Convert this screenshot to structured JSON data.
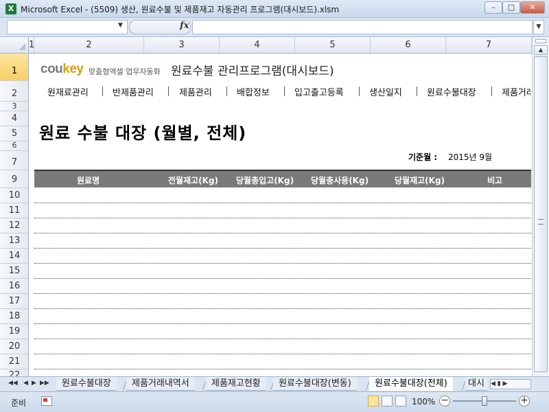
{
  "window": {
    "app_icon": "X",
    "title": "Microsoft Excel - (5509) 생산, 원료수불 및 제품재고 자동관리 프로그램(대시보드).xlsm",
    "min_icon": "minimize-icon",
    "max_icon": "maximize-icon",
    "close_icon": "close-icon"
  },
  "formula_bar": {
    "name_box": "",
    "fx": "fx",
    "formula": ""
  },
  "columns": [
    "1",
    "2",
    "3",
    "4",
    "5",
    "6",
    "7"
  ],
  "rows": [
    "1",
    "2",
    "3",
    "4",
    "5",
    "6",
    "7",
    "9",
    "10",
    "11",
    "12",
    "13",
    "14",
    "15",
    "16",
    "17",
    "18",
    "19",
    "20",
    "21",
    "22"
  ],
  "header": {
    "logo_main": "cou",
    "logo_accent": "key",
    "logo_tag": "맞춤형엑셀 업무자동화",
    "app_title": "원료수불 관리프로그램(대시보드)"
  },
  "menu": [
    "원재료관리",
    "반제품관리",
    "제품관리",
    "배합정보",
    "입고출고등록",
    "생산일지",
    "원료수불대장",
    "제품거래"
  ],
  "page": {
    "heading": "원료 수불 대장 (월별, 전체)",
    "base_label": "기준월 :",
    "base_value": "2015년  9월"
  },
  "table": {
    "headers": [
      "원료명",
      "전월재고(Kg)",
      "당월총입고(Kg)",
      "당월총사용(Kg)",
      "당월재고(Kg)",
      "비고"
    ],
    "rows": []
  },
  "sheet_tabs": [
    "원료수불대장",
    "제품거래내역서",
    "제품재고현황",
    "원료수불대장(변동)",
    "원료수불대장(전체)",
    "대시"
  ],
  "active_sheet": "원료수불대장(전체)",
  "status": {
    "mode": "준비",
    "zoom": "100%",
    "zoom_level_percent": 100
  }
}
